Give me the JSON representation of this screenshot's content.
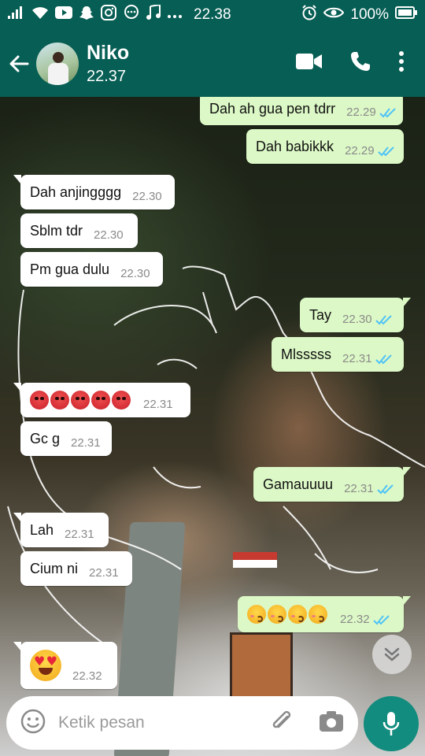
{
  "status_bar": {
    "time": "22.38",
    "battery_percent": "100%",
    "icons": [
      "signal-icon",
      "wifi-icon",
      "youtube-icon",
      "snapchat-icon",
      "instagram-icon",
      "messenger-icon",
      "music-icon",
      "more-dots-icon",
      "alarm-icon",
      "eye-icon",
      "battery-icon"
    ]
  },
  "header": {
    "contact_name": "Niko",
    "last_seen": "22.37",
    "icons": [
      "back-arrow-icon",
      "video-call-icon",
      "phone-icon",
      "more-vert-icon"
    ]
  },
  "messages": [
    {
      "dir": "out",
      "text": "Dah ah gua pen tdrr",
      "time": "22.29",
      "read": true
    },
    {
      "dir": "out",
      "text": "Dah babikkk",
      "time": "22.29",
      "read": true
    },
    {
      "dir": "in",
      "text": "Dah anjingggg",
      "time": "22.30"
    },
    {
      "dir": "in",
      "text": "Sblm tdr",
      "time": "22.30"
    },
    {
      "dir": "in",
      "text": "Pm gua dulu",
      "time": "22.30"
    },
    {
      "dir": "out",
      "text": "Tay",
      "time": "22.30",
      "read": true
    },
    {
      "dir": "out",
      "text": "Mlsssss",
      "time": "22.31",
      "read": true
    },
    {
      "dir": "in",
      "emoji": "angry-face x5",
      "time": "22.31"
    },
    {
      "dir": "in",
      "text": "Gc g",
      "time": "22.31"
    },
    {
      "dir": "out",
      "text": "Gamauuuu",
      "time": "22.31",
      "read": true
    },
    {
      "dir": "in",
      "text": "Lah",
      "time": "22.31"
    },
    {
      "dir": "in",
      "text": "Cium ni",
      "time": "22.31"
    },
    {
      "dir": "out",
      "emoji": "kissing-face x4",
      "time": "22.32",
      "read": true
    },
    {
      "dir": "in",
      "emoji": "heart-eyes-face",
      "time": "22.32"
    }
  ],
  "input": {
    "placeholder": "Ketik pesan",
    "icons": [
      "emoji-icon",
      "attach-icon",
      "camera-icon",
      "mic-icon"
    ]
  },
  "colors": {
    "header": "#075e54",
    "outgoing_bubble": "#dcf8c6",
    "incoming_bubble": "#ffffff",
    "read_tick": "#4fc3f7",
    "mic_button": "#128c7e"
  }
}
